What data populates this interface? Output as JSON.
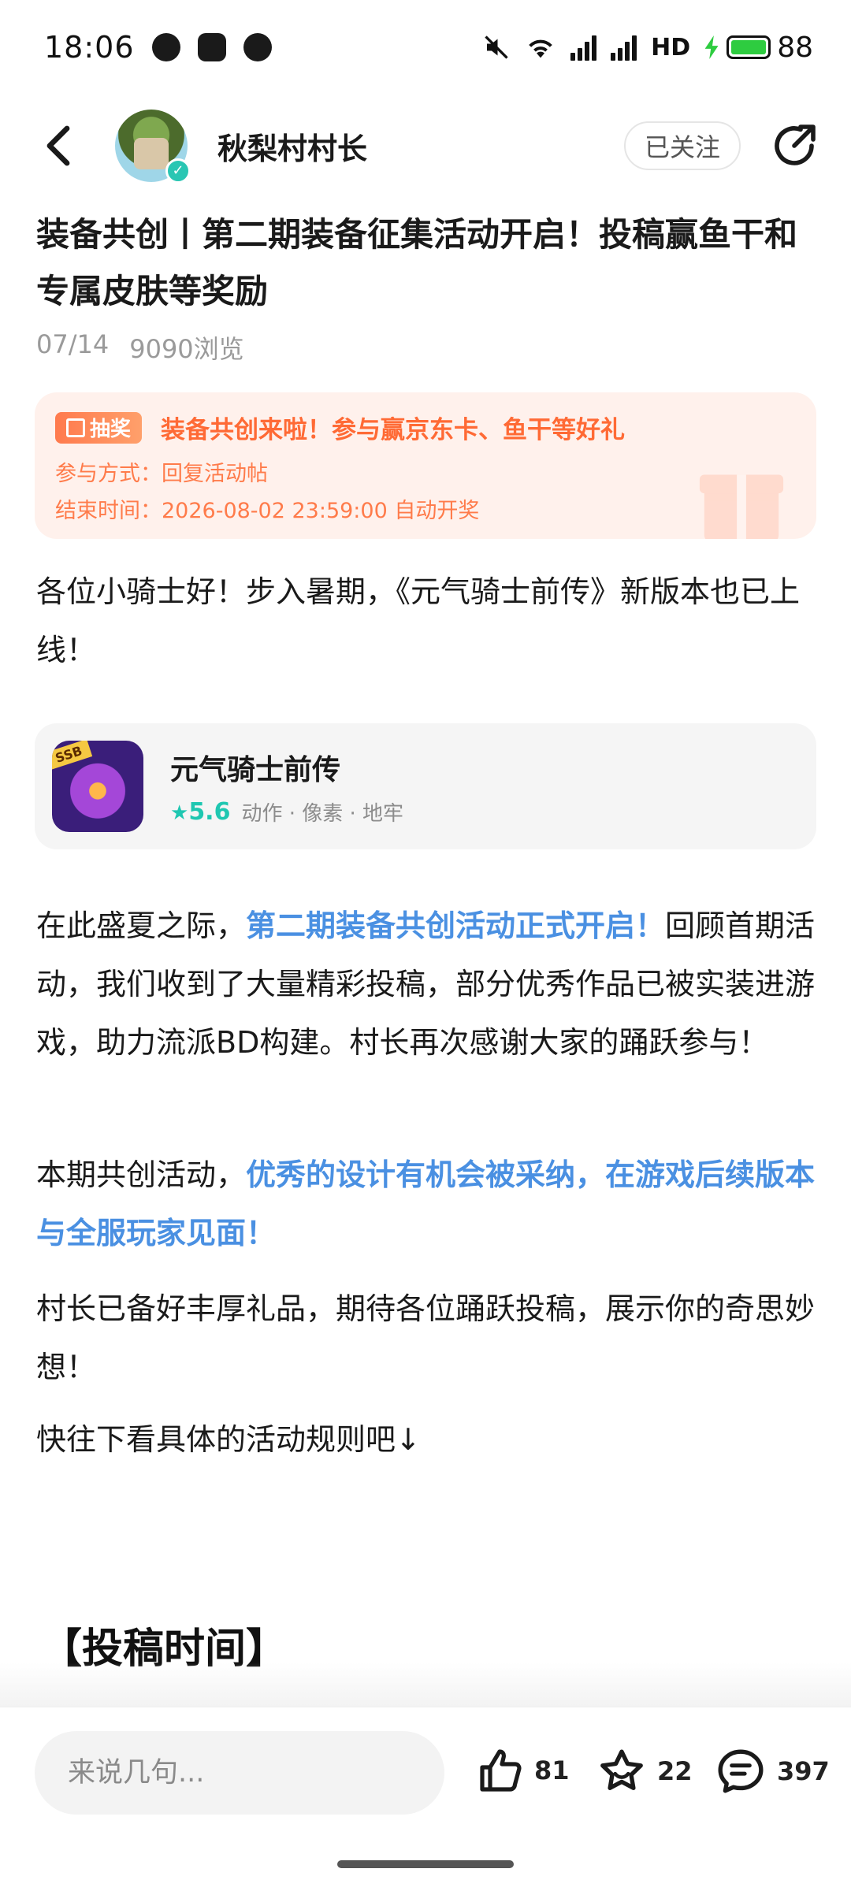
{
  "status_bar": {
    "time": "18:06",
    "network": "HD",
    "battery": "88"
  },
  "header": {
    "author": "秋梨村村长",
    "follow_label": "已关注"
  },
  "post": {
    "title": "装备共创丨第二期装备征集活动开启！投稿赢鱼干和专属皮肤等奖励",
    "date": "07/14",
    "views": "9090浏览"
  },
  "lottery": {
    "badge": "抽奖",
    "title": "装备共创来啦！参与赢京东卡、鱼干等好礼",
    "method": "参与方式：回复活动帖",
    "end_time": "结束时间：2026-08-02 23:59:00 自动开奖"
  },
  "content": {
    "p1": "各位小骑士好！步入暑期，《元气骑士前传》新版本也已上线！",
    "p2_pre": "在此盛夏之际，",
    "p2_hl": "第二期装备共创活动正式开启！",
    "p2_post": "回顾首期活动，我们收到了大量精彩投稿，部分优秀作品已被实装进游戏，助力流派BD构建。村长再次感谢大家的踊跃参与！",
    "p3_pre": "本期共创活动，",
    "p3_hl": "优秀的设计有机会被采纳，在游戏后续版本与全服玩家见面！",
    "p4": "村长已备好丰厚礼品，期待各位踊跃投稿，展示你的奇思妙想！",
    "p5": "快往下看具体的活动规则吧↓",
    "section_heading": "【投稿时间】"
  },
  "game_card": {
    "name": "元气骑士前传",
    "score": "5.6",
    "tags": "动作 · 像素 · 地牢",
    "icon_badge": "SSB"
  },
  "bottom_bar": {
    "comment_placeholder": "来说几句...",
    "likes": "81",
    "favorites": "22",
    "comments": "397"
  },
  "colors": {
    "accent": "#4a90e2",
    "lottery": "#ff6a35",
    "score": "#1fc7b1"
  }
}
